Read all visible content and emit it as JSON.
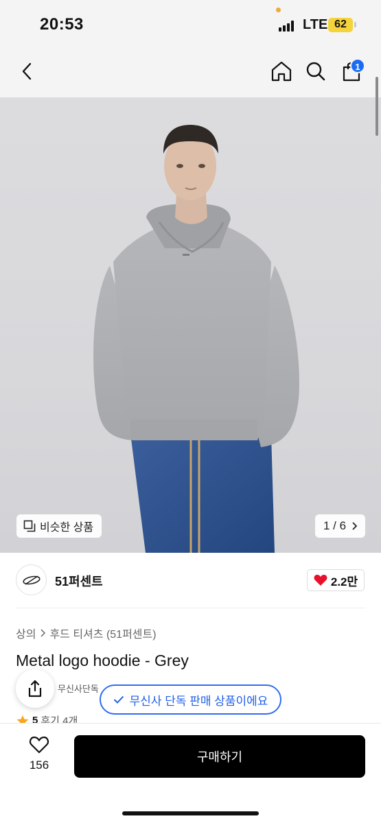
{
  "status_bar": {
    "time": "20:53",
    "network": "LTE",
    "battery": "62"
  },
  "header": {
    "back_icon": "chevron-left-icon",
    "home_icon": "home-icon",
    "search_icon": "search-icon",
    "cart_icon": "shopping-bag-icon",
    "cart_count": "1"
  },
  "gallery": {
    "similar_label": "비슷한 상품",
    "page_indicator": "1 / 6",
    "current": 1,
    "total": 6
  },
  "brand": {
    "name": "51퍼센트",
    "likes": "2.2만"
  },
  "breadcrumb": {
    "category": "상의",
    "subcategory": "후드 티셔츠 (51퍼센트)"
  },
  "product": {
    "title": "Metal logo hoodie - Grey",
    "exclusive_tag": "무신사단독",
    "exclusive_toast": "무신사 단독 판매 상품이에요",
    "rating": "5",
    "reviews": "후기 4개"
  },
  "bottom_bar": {
    "wishlist_count": "156",
    "buy_label": "구매하기"
  },
  "colors": {
    "accent_blue": "#1b6cf2",
    "like_red": "#e8112d",
    "star": "#f5a623",
    "buy_button": "#000000"
  }
}
